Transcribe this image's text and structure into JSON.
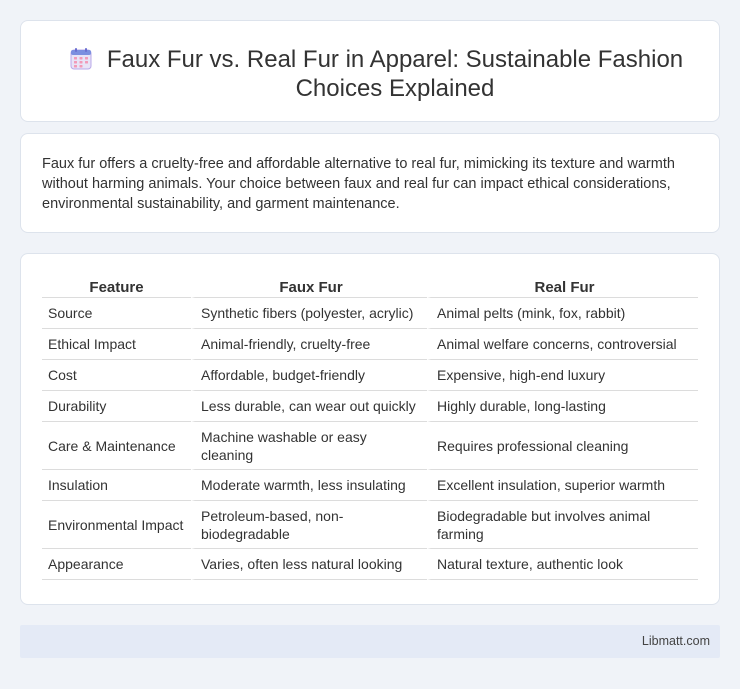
{
  "header": {
    "title": "Faux Fur vs. Real Fur in Apparel: Sustainable Fashion Choices Explained",
    "icon": "calendar-icon"
  },
  "intro": {
    "text": "Faux fur offers a cruelty-free and affordable alternative to real fur, mimicking its texture and warmth without harming animals. Your choice between faux and real fur can impact ethical considerations, environmental sustainability, and garment maintenance."
  },
  "table": {
    "headers": [
      "Feature",
      "Faux Fur",
      "Real Fur"
    ],
    "rows": [
      [
        "Source",
        "Synthetic fibers (polyester, acrylic)",
        "Animal pelts (mink, fox, rabbit)"
      ],
      [
        "Ethical Impact",
        "Animal-friendly, cruelty-free",
        "Animal welfare concerns, controversial"
      ],
      [
        "Cost",
        "Affordable, budget-friendly",
        "Expensive, high-end luxury"
      ],
      [
        "Durability",
        "Less durable, can wear out quickly",
        "Highly durable, long-lasting"
      ],
      [
        "Care & Maintenance",
        "Machine washable or easy cleaning",
        "Requires professional cleaning"
      ],
      [
        "Insulation",
        "Moderate warmth, less insulating",
        "Excellent insulation, superior warmth"
      ],
      [
        "Environmental Impact",
        "Petroleum-based, non-biodegradable",
        "Biodegradable but involves animal farming"
      ],
      [
        "Appearance",
        "Varies, often less natural looking",
        "Natural texture, authentic look"
      ]
    ]
  },
  "footer": {
    "brand": "Libmatt.com"
  }
}
